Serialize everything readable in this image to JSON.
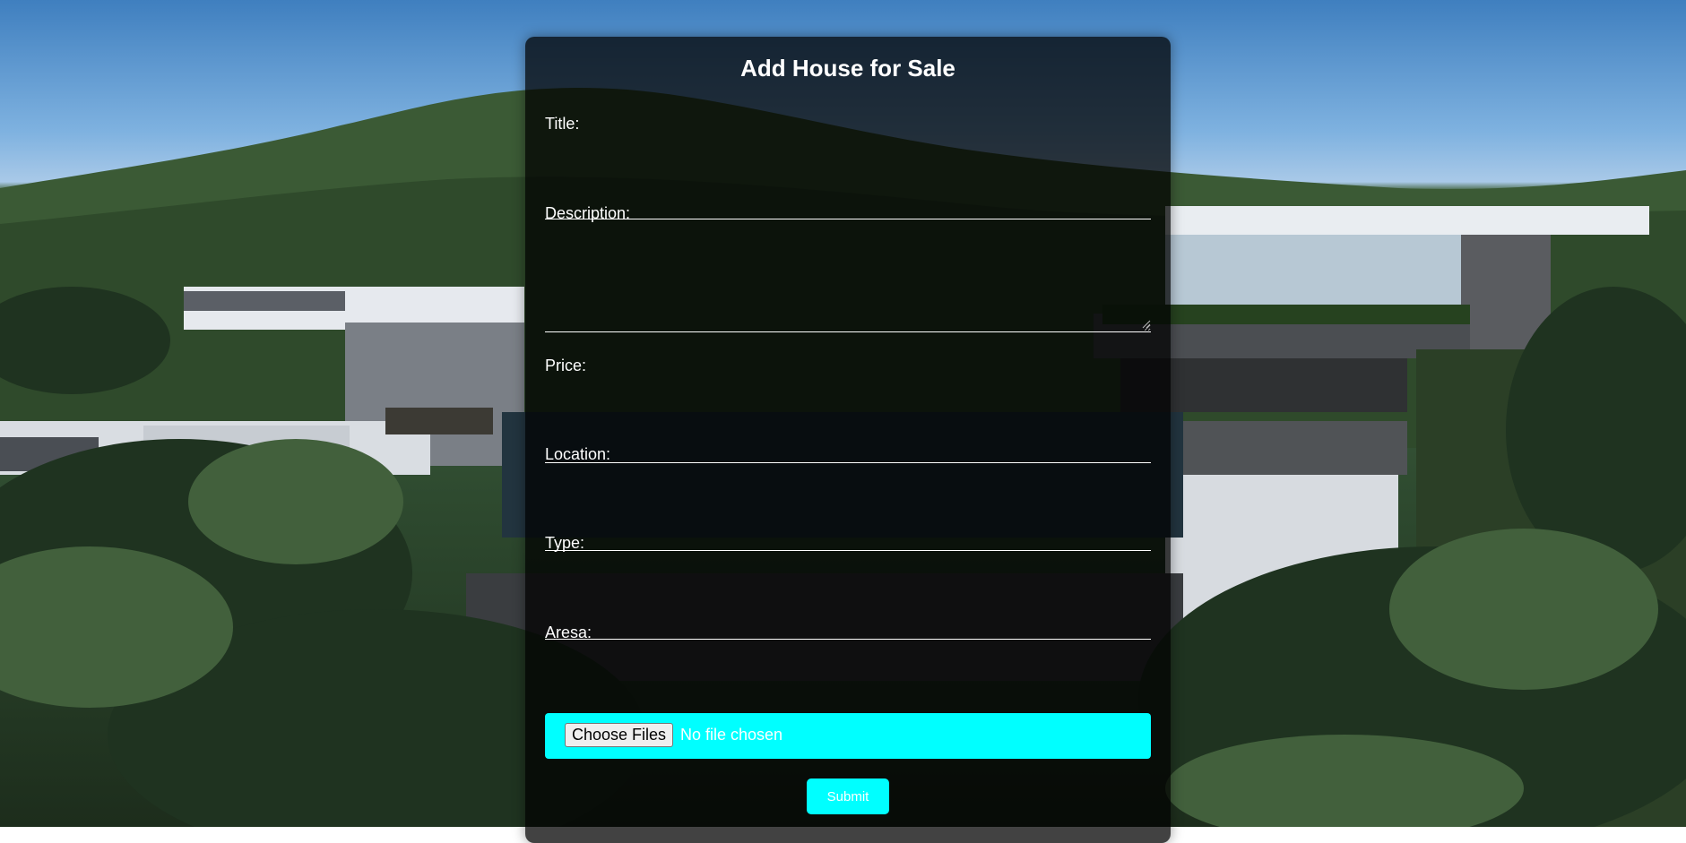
{
  "form": {
    "title": "Add House for Sale",
    "fields": [
      {
        "label": "Title:",
        "value": ""
      },
      {
        "label": "Description:",
        "value": ""
      },
      {
        "label": "Price:",
        "value": ""
      },
      {
        "label": "Location:",
        "value": ""
      },
      {
        "label": "Type:",
        "value": ""
      },
      {
        "label": "Aresa:",
        "value": ""
      }
    ],
    "file_button_label": "Choose Files",
    "file_status": "No file chosen",
    "submit_label": "Submit"
  },
  "colors": {
    "accent": "#00ffff",
    "panel": "rgba(0,0,0,0.74)",
    "text": "#ffffff"
  }
}
